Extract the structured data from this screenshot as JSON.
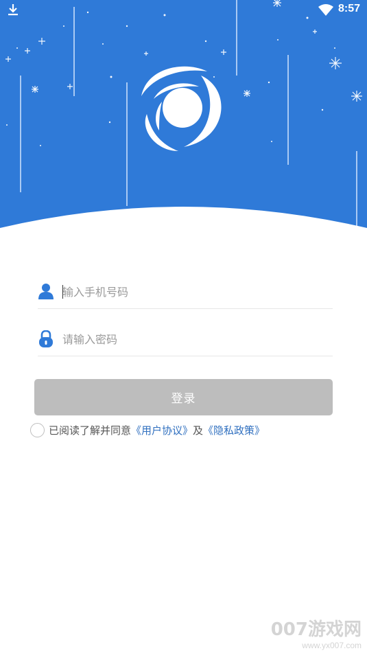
{
  "status_bar": {
    "time": "8:57"
  },
  "login": {
    "phone_placeholder": "输入手机号码",
    "password_placeholder": "请输入密码",
    "login_label": "登录"
  },
  "agreement": {
    "prefix": "已阅读了解并同意",
    "user_agreement": "《用户协议》",
    "connector": "及",
    "privacy_policy": "《隐私政策》"
  },
  "watermark": {
    "brand": "007游戏网",
    "url": "www.yx007.com"
  },
  "colors": {
    "primary": "#2f7ad8",
    "button_disabled": "#bdbdbd",
    "link": "#2f6fbf",
    "icon": "#2f7ad8"
  }
}
